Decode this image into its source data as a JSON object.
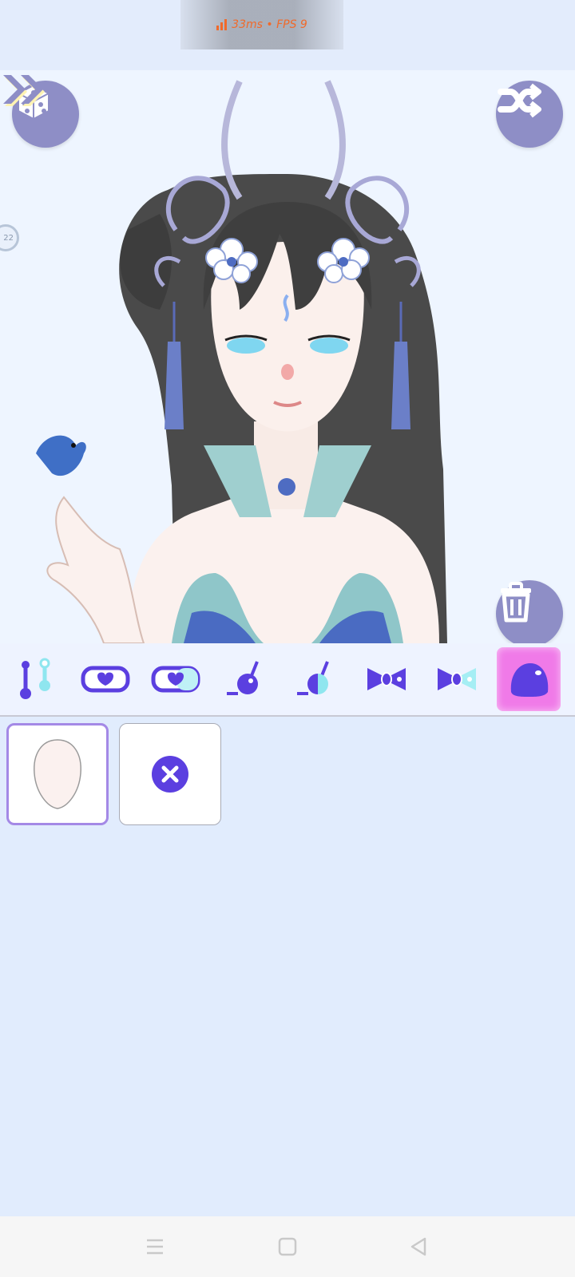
{
  "status": {
    "perf_text": "33ms • FPS 9"
  },
  "stage": {
    "side_counter": "22"
  },
  "buttons": {
    "random_icon": "dice-icon",
    "shuffle_icon": "shuffle-icon",
    "next_icon": "double-chevron-right-icon",
    "delete_icon": "trash-icon"
  },
  "categories": [
    {
      "icon": "pin-toggle-icon"
    },
    {
      "icon": "heart-glasses-icon"
    },
    {
      "icon": "heart-glasses-color-icon"
    },
    {
      "icon": "earring-icon"
    },
    {
      "icon": "earring-color-icon"
    },
    {
      "icon": "bow-icon"
    },
    {
      "icon": "bow-color-icon"
    },
    {
      "icon": "slime-body-icon",
      "active": true
    }
  ],
  "items": [
    {
      "icon": "face-shape-icon",
      "selected": true
    },
    {
      "icon": "none-x-icon",
      "selected": false
    }
  ],
  "colors": {
    "accent": "#5b3fe0",
    "button_bg": "#8e8ec6",
    "active_tab": "#f07ae8",
    "background": "#e1ecfd"
  },
  "nav": [
    "menu-icon",
    "home-icon",
    "back-icon"
  ]
}
